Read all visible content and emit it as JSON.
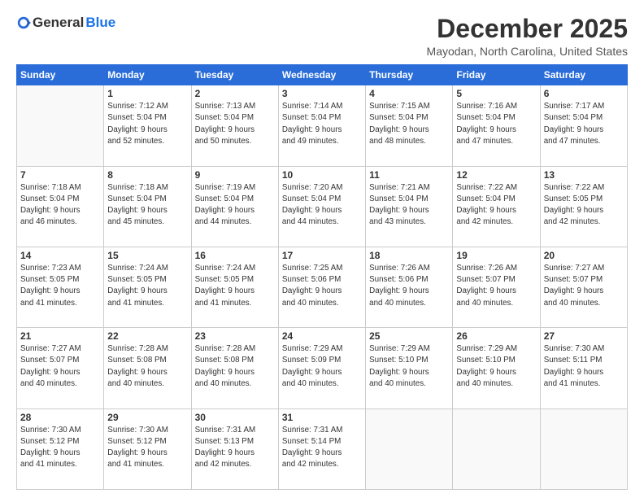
{
  "logo": {
    "general": "General",
    "blue": "Blue"
  },
  "header": {
    "month": "December 2025",
    "location": "Mayodan, North Carolina, United States"
  },
  "days_of_week": [
    "Sunday",
    "Monday",
    "Tuesday",
    "Wednesday",
    "Thursday",
    "Friday",
    "Saturday"
  ],
  "weeks": [
    [
      {
        "day": "",
        "info": ""
      },
      {
        "day": "1",
        "info": "Sunrise: 7:12 AM\nSunset: 5:04 PM\nDaylight: 9 hours\nand 52 minutes."
      },
      {
        "day": "2",
        "info": "Sunrise: 7:13 AM\nSunset: 5:04 PM\nDaylight: 9 hours\nand 50 minutes."
      },
      {
        "day": "3",
        "info": "Sunrise: 7:14 AM\nSunset: 5:04 PM\nDaylight: 9 hours\nand 49 minutes."
      },
      {
        "day": "4",
        "info": "Sunrise: 7:15 AM\nSunset: 5:04 PM\nDaylight: 9 hours\nand 48 minutes."
      },
      {
        "day": "5",
        "info": "Sunrise: 7:16 AM\nSunset: 5:04 PM\nDaylight: 9 hours\nand 47 minutes."
      },
      {
        "day": "6",
        "info": "Sunrise: 7:17 AM\nSunset: 5:04 PM\nDaylight: 9 hours\nand 47 minutes."
      }
    ],
    [
      {
        "day": "7",
        "info": "Sunrise: 7:18 AM\nSunset: 5:04 PM\nDaylight: 9 hours\nand 46 minutes."
      },
      {
        "day": "8",
        "info": "Sunrise: 7:18 AM\nSunset: 5:04 PM\nDaylight: 9 hours\nand 45 minutes."
      },
      {
        "day": "9",
        "info": "Sunrise: 7:19 AM\nSunset: 5:04 PM\nDaylight: 9 hours\nand 44 minutes."
      },
      {
        "day": "10",
        "info": "Sunrise: 7:20 AM\nSunset: 5:04 PM\nDaylight: 9 hours\nand 44 minutes."
      },
      {
        "day": "11",
        "info": "Sunrise: 7:21 AM\nSunset: 5:04 PM\nDaylight: 9 hours\nand 43 minutes."
      },
      {
        "day": "12",
        "info": "Sunrise: 7:22 AM\nSunset: 5:04 PM\nDaylight: 9 hours\nand 42 minutes."
      },
      {
        "day": "13",
        "info": "Sunrise: 7:22 AM\nSunset: 5:05 PM\nDaylight: 9 hours\nand 42 minutes."
      }
    ],
    [
      {
        "day": "14",
        "info": "Sunrise: 7:23 AM\nSunset: 5:05 PM\nDaylight: 9 hours\nand 41 minutes."
      },
      {
        "day": "15",
        "info": "Sunrise: 7:24 AM\nSunset: 5:05 PM\nDaylight: 9 hours\nand 41 minutes."
      },
      {
        "day": "16",
        "info": "Sunrise: 7:24 AM\nSunset: 5:05 PM\nDaylight: 9 hours\nand 41 minutes."
      },
      {
        "day": "17",
        "info": "Sunrise: 7:25 AM\nSunset: 5:06 PM\nDaylight: 9 hours\nand 40 minutes."
      },
      {
        "day": "18",
        "info": "Sunrise: 7:26 AM\nSunset: 5:06 PM\nDaylight: 9 hours\nand 40 minutes."
      },
      {
        "day": "19",
        "info": "Sunrise: 7:26 AM\nSunset: 5:07 PM\nDaylight: 9 hours\nand 40 minutes."
      },
      {
        "day": "20",
        "info": "Sunrise: 7:27 AM\nSunset: 5:07 PM\nDaylight: 9 hours\nand 40 minutes."
      }
    ],
    [
      {
        "day": "21",
        "info": "Sunrise: 7:27 AM\nSunset: 5:07 PM\nDaylight: 9 hours\nand 40 minutes."
      },
      {
        "day": "22",
        "info": "Sunrise: 7:28 AM\nSunset: 5:08 PM\nDaylight: 9 hours\nand 40 minutes."
      },
      {
        "day": "23",
        "info": "Sunrise: 7:28 AM\nSunset: 5:08 PM\nDaylight: 9 hours\nand 40 minutes."
      },
      {
        "day": "24",
        "info": "Sunrise: 7:29 AM\nSunset: 5:09 PM\nDaylight: 9 hours\nand 40 minutes."
      },
      {
        "day": "25",
        "info": "Sunrise: 7:29 AM\nSunset: 5:10 PM\nDaylight: 9 hours\nand 40 minutes."
      },
      {
        "day": "26",
        "info": "Sunrise: 7:29 AM\nSunset: 5:10 PM\nDaylight: 9 hours\nand 40 minutes."
      },
      {
        "day": "27",
        "info": "Sunrise: 7:30 AM\nSunset: 5:11 PM\nDaylight: 9 hours\nand 41 minutes."
      }
    ],
    [
      {
        "day": "28",
        "info": "Sunrise: 7:30 AM\nSunset: 5:12 PM\nDaylight: 9 hours\nand 41 minutes."
      },
      {
        "day": "29",
        "info": "Sunrise: 7:30 AM\nSunset: 5:12 PM\nDaylight: 9 hours\nand 41 minutes."
      },
      {
        "day": "30",
        "info": "Sunrise: 7:31 AM\nSunset: 5:13 PM\nDaylight: 9 hours\nand 42 minutes."
      },
      {
        "day": "31",
        "info": "Sunrise: 7:31 AM\nSunset: 5:14 PM\nDaylight: 9 hours\nand 42 minutes."
      },
      {
        "day": "",
        "info": ""
      },
      {
        "day": "",
        "info": ""
      },
      {
        "day": "",
        "info": ""
      }
    ]
  ]
}
